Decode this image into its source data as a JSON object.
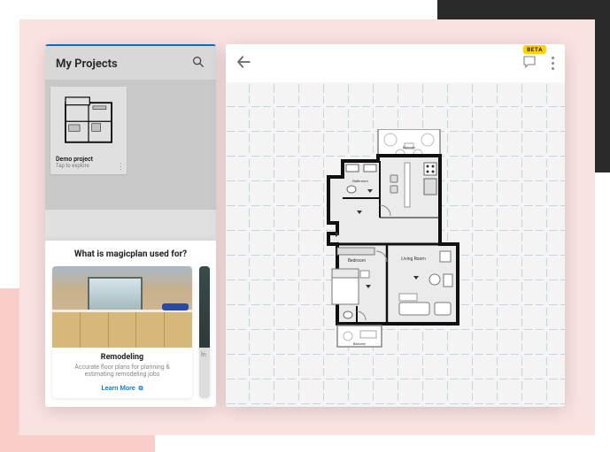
{
  "leftPhone": {
    "headerTitle": "My Projects",
    "project": {
      "name": "Demo project",
      "subtitle": "Tap to explore"
    },
    "sheet": {
      "title": "What is magicplan used for?",
      "card1": {
        "title": "Remodeling",
        "description": "Accurate floor plans for planning & estimating remodeling jobs",
        "cta": "Learn More"
      },
      "card2PeekLabel": "In"
    }
  },
  "rightPanel": {
    "betaLabel": "BETA",
    "rooms": {
      "balconyTop": "Balcony",
      "bathroom": "Bathroom",
      "livingRoom": "Living Room",
      "bedroom": "Bedroom",
      "balconyBottom": "Balcony"
    }
  },
  "colors": {
    "accent": "#0d7dd7",
    "beta": "#ffd200",
    "peach": "#fae2e1",
    "pink": "#f9cdca",
    "dark": "#2a2a2a"
  }
}
